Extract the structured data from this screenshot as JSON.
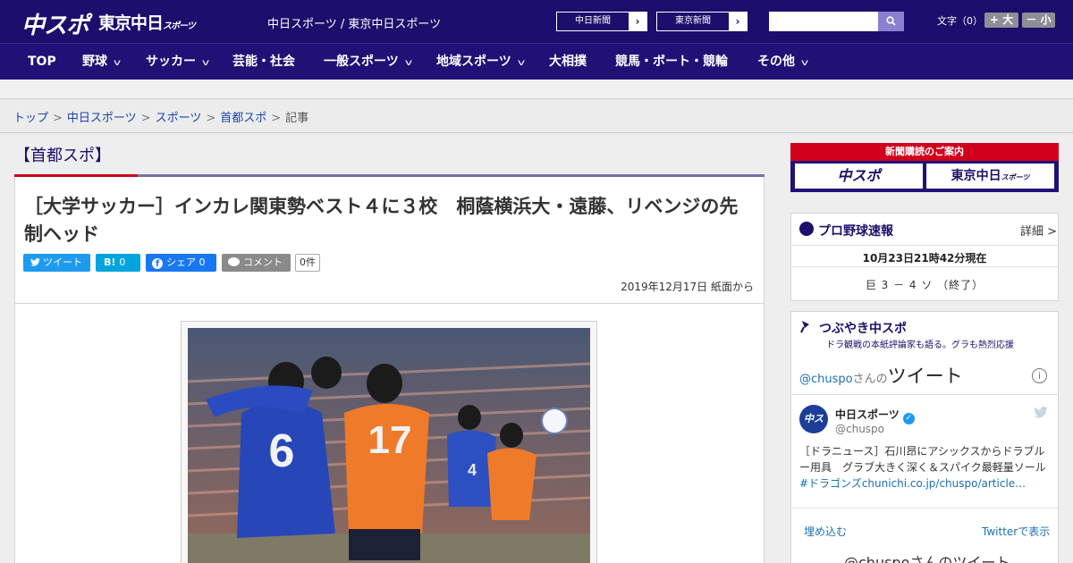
{
  "header": {
    "logo_chuspo": "中スポ",
    "logo_tokyo": "東京中日",
    "logo_tokyo_sub": "スポーツ",
    "site_link": "中日スポーツ / 東京中日スポーツ",
    "chunichi_link": "中日新聞",
    "tokyo_link": "東京新聞",
    "search_placeholder": "",
    "text_size_label": "文字（0）",
    "text_size_up": "+ 大",
    "text_size_down": "－ 小"
  },
  "nav": {
    "items": [
      {
        "label": "TOP"
      },
      {
        "label": "野球"
      },
      {
        "label": "サッカー"
      },
      {
        "label": "芸能・社会"
      },
      {
        "label": "一般スポーツ"
      },
      {
        "label": "地域スポーツ"
      },
      {
        "label": "大相撲"
      },
      {
        "label": "競馬・ボート・競輪"
      },
      {
        "label": "その他"
      }
    ]
  },
  "breadcrumb": {
    "items": [
      "トップ",
      "中日スポーツ",
      "スポーツ",
      "首都スポ"
    ],
    "current": "記事",
    "separator": ">"
  },
  "article": {
    "category": "【首都スポ】",
    "headline": "［大学サッカー］インカレ関東勢ベスト４に３校　桐蔭横浜大・遠藤、リベンジの先制ヘッド",
    "share": {
      "tweet": "ツイート",
      "hatena_icon": "B!",
      "hatena_count": "0",
      "facebook": "シェア",
      "facebook_count": "0",
      "comment": "コメント",
      "comment_count": "0件"
    },
    "date": "2019年12月17日 紙面から",
    "photo": {
      "player_numbers": [
        "6",
        "17",
        "4"
      ]
    }
  },
  "sidebar": {
    "subscribe": {
      "label": "新聞購読のご案内",
      "logo_chuspo": "中スポ",
      "logo_tokyo": "東京中日",
      "logo_tokyo_sub": "スポーツ"
    },
    "baseball": {
      "title": "プロ野球速報",
      "detail": "詳細 >",
      "time": "10月23日21時42分現在",
      "score": "巨 3 － 4 ソ （終了）"
    },
    "tweets": {
      "title": "つぶやき中スポ",
      "subtitle": "ドラ観戦の本紙評論家も語る。グラも熱烈応援",
      "head_handle": "@chuspo",
      "head_mid": "さんの",
      "head_big": "ツイート",
      "account_name": "中日スポーツ",
      "account_handle": "@chuspo",
      "avatar_text": "中ス",
      "tweet_text": "［ドラニュース］石川昂にアシックスからドラブルー用具　グラブ大きく深く＆スパイク最軽量ソール",
      "tweet_link": "#ドラゴンズchunichi.co.jp/chuspo/article…",
      "embed": "埋め込む",
      "view": "Twitterで表示",
      "more": "@chuspoさんのツイート"
    }
  },
  "colors": {
    "header_bg": "#1c0e6c",
    "nav_bg": "#211176",
    "accent_red": "#d0001c",
    "twitter_blue": "#1d9bf0",
    "facebook_blue": "#1877f2",
    "hatena_blue": "#00a4de"
  },
  "icons": [
    "search-icon",
    "chevron-right-icon",
    "chevron-down-icon",
    "twitter-bird-icon",
    "hatena-icon",
    "facebook-icon",
    "comment-icon",
    "baseball-icon",
    "microphone-icon",
    "info-icon",
    "verified-badge-icon"
  ]
}
